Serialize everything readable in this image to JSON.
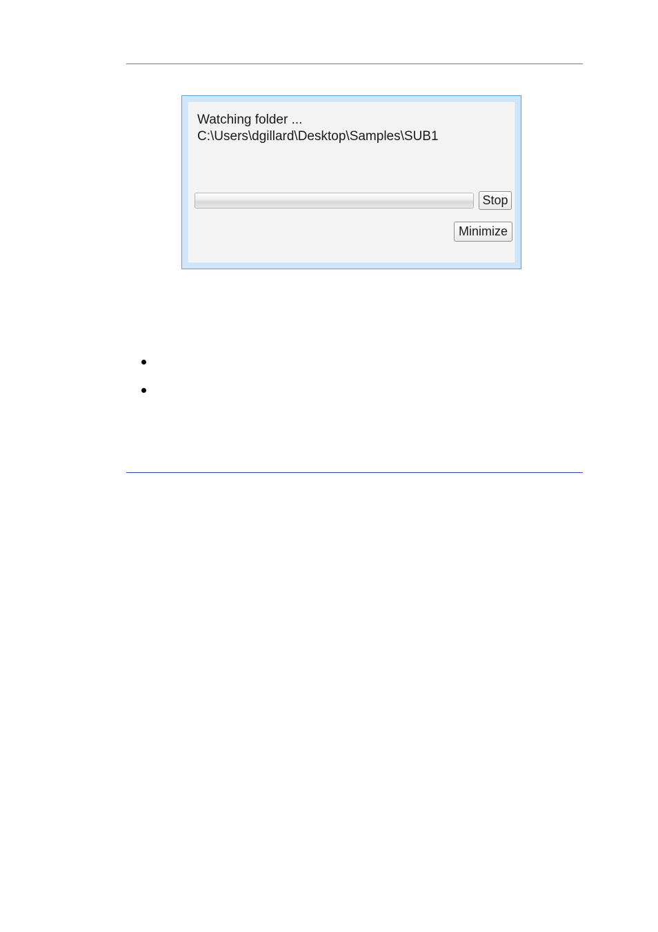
{
  "dialog": {
    "status_line1": "Watching folder ...",
    "status_line2": "C:\\Users\\dgillard\\Desktop\\Samples\\SUB1",
    "stop_label": "Stop",
    "minimize_label": "Minimize"
  }
}
